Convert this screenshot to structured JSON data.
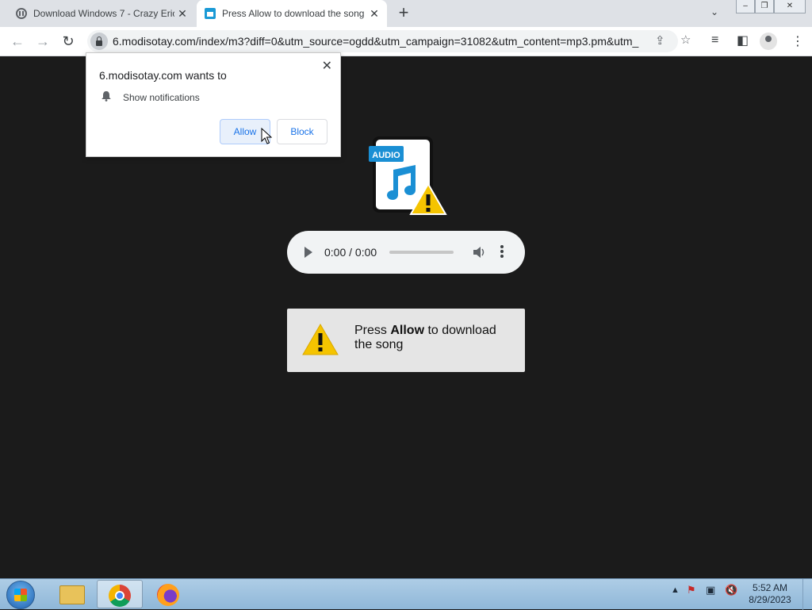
{
  "browser": {
    "tabs": [
      {
        "title": "Download Windows 7 - Crazy Eric",
        "close": "✕"
      },
      {
        "title": "Press Allow to download the song",
        "close": "✕"
      }
    ],
    "new_tab": "+",
    "url": "6.modisotay.com/index/m3?diff=0&utm_source=ogdd&utm_campaign=31082&utm_content=mp3.pm&utm_"
  },
  "popup": {
    "heading": "6.modisotay.com wants to",
    "permission": "Show notifications",
    "allow_label": "Allow",
    "block_label": "Block",
    "close": "✕"
  },
  "page": {
    "audio_badge": "AUDIO",
    "player": {
      "time": "0:00 / 0:00"
    },
    "message": {
      "prefix": "Press ",
      "bold": "Allow",
      "suffix": " to download the song"
    }
  },
  "taskbar": {
    "time": "5:52 AM",
    "date": "8/29/2023"
  }
}
